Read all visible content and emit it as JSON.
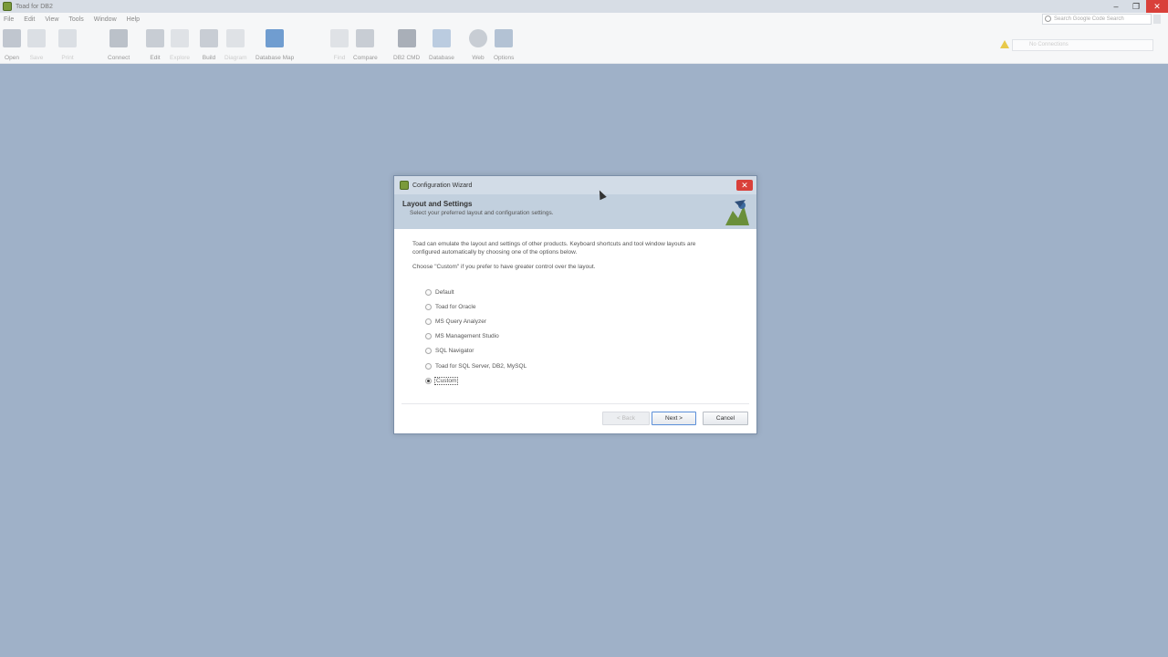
{
  "window": {
    "title": "Toad for DB2"
  },
  "menubar": {
    "items": [
      "File",
      "Edit",
      "View",
      "Tools",
      "Window",
      "Help"
    ]
  },
  "search": {
    "placeholder": "Search Google Code Search"
  },
  "toolbar": {
    "buttons": [
      {
        "label": "Open",
        "icon": "folder-icon",
        "enabled": true
      },
      {
        "label": "Save",
        "icon": "save-icon",
        "enabled": false
      },
      {
        "label": "Print",
        "icon": "print-icon",
        "enabled": false
      },
      {
        "label": "Connect",
        "icon": "connect-icon",
        "enabled": true
      },
      {
        "label": "Edit",
        "icon": "edit-icon",
        "enabled": true
      },
      {
        "label": "Explore",
        "icon": "explore-icon",
        "enabled": false
      },
      {
        "label": "Build",
        "icon": "build-icon",
        "enabled": true
      },
      {
        "label": "Diagram",
        "icon": "diagram-icon",
        "enabled": false
      },
      {
        "label": "Database Map",
        "icon": "database-map-icon",
        "enabled": true
      },
      {
        "label": "Find",
        "icon": "find-icon",
        "enabled": false
      },
      {
        "label": "Compare",
        "icon": "compare-icon",
        "enabled": true
      },
      {
        "label": "DB2 CMD",
        "icon": "db2-cmd-icon",
        "enabled": true
      },
      {
        "label": "Database",
        "icon": "database-icon",
        "enabled": true
      },
      {
        "label": "Web",
        "icon": "globe-icon",
        "enabled": true
      },
      {
        "label": "Options",
        "icon": "options-icon",
        "enabled": true
      }
    ],
    "connection": {
      "placeholder": "No Connections"
    }
  },
  "dialog": {
    "title": "Configuration Wizard",
    "header_title": "Layout and Settings",
    "header_subtitle": "Select your preferred layout and configuration settings.",
    "description": "Toad can emulate the layout and settings of other products.  Keyboard shortcuts and tool window layouts are configured automatically by choosing one of the options below.",
    "description2": "Choose \"Custom\" if you prefer to have greater control over the layout.",
    "options": [
      {
        "label": "Default",
        "selected": false
      },
      {
        "label": "Toad for Oracle",
        "selected": false
      },
      {
        "label": "MS Query Analyzer",
        "selected": false
      },
      {
        "label": "MS Management Studio",
        "selected": false
      },
      {
        "label": "SQL Navigator",
        "selected": false
      },
      {
        "label": "Toad for SQL Server, DB2, MySQL",
        "selected": false
      },
      {
        "label": "Custom",
        "selected": true
      }
    ],
    "buttons": {
      "back": "< Back",
      "next": "Next >",
      "cancel": "Cancel"
    }
  }
}
